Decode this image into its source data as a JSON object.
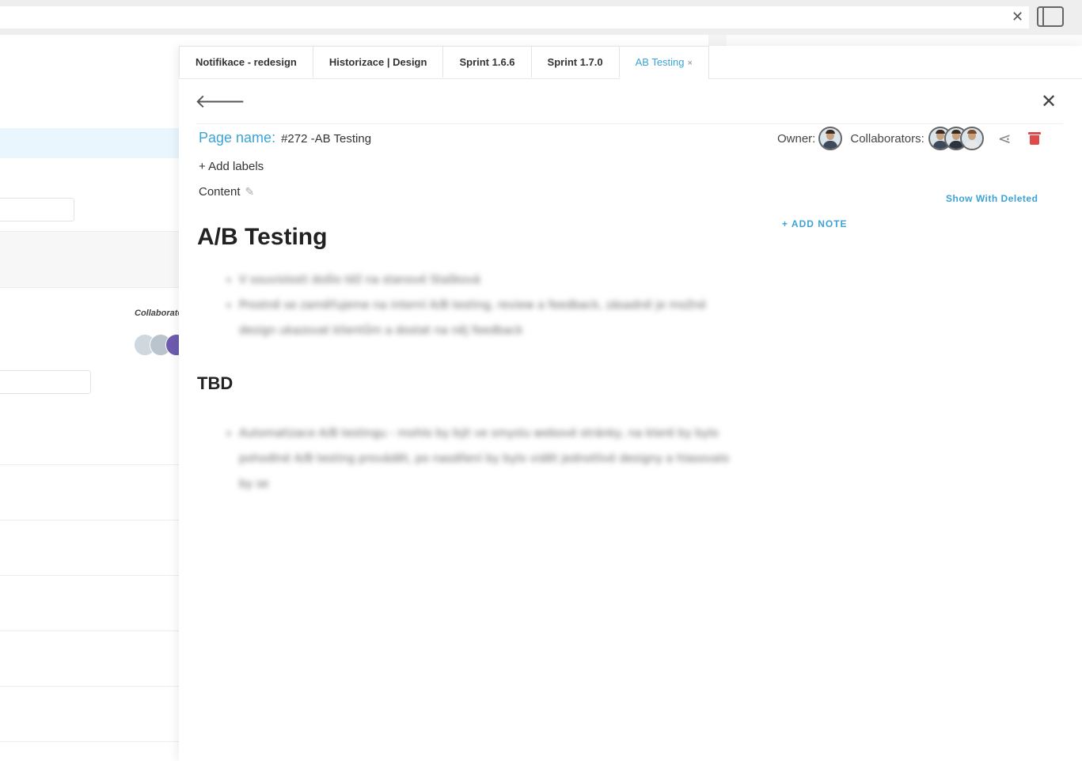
{
  "topbar": {
    "close_glyph": "✕",
    "panel_icon": "sidebar-toggle-icon"
  },
  "background": {
    "collaborators_label": "Collaborato"
  },
  "tabs": [
    {
      "label": "Notifikace - redesign",
      "active": false
    },
    {
      "label": "Historizace | Design",
      "active": false
    },
    {
      "label": "Sprint 1.6.6",
      "active": false
    },
    {
      "label": "Sprint 1.7.0",
      "active": false
    },
    {
      "label": "AB Testing",
      "active": true,
      "close": "×"
    }
  ],
  "header": {
    "back_glyph": "🡐",
    "close_glyph": "✕",
    "page_name_label": "Page name:",
    "page_name_value": "#272 -AB Testing",
    "add_labels": "+ Add labels",
    "content_label": "Content",
    "owner_label": "Owner:",
    "collaborators_label": "Collaborators:",
    "show_deleted": "Show With Deleted",
    "add_note": "+ ADD NOTE"
  },
  "document": {
    "heading1": "A/B Testing",
    "list1": [
      "V souvislosti došlo též na stanové Stašková",
      "Prostně se zaměřujeme na interní A/B testing, review a feedback, zásadně je možné design ukazovat klientům a dostat na něj feedback"
    ],
    "list1_link": "Stašková",
    "heading2": "TBD",
    "list2": [
      "Automatizace A/B testingu - mohlo by být ve smyslu webové stránky, na které by bylo pohodlné A/B testing provádět, po nasdílení by bylo vidět jednotlivé designy a hlasovalo by se"
    ]
  },
  "colors": {
    "accent": "#3ba3d6",
    "danger": "#e04a4a"
  }
}
